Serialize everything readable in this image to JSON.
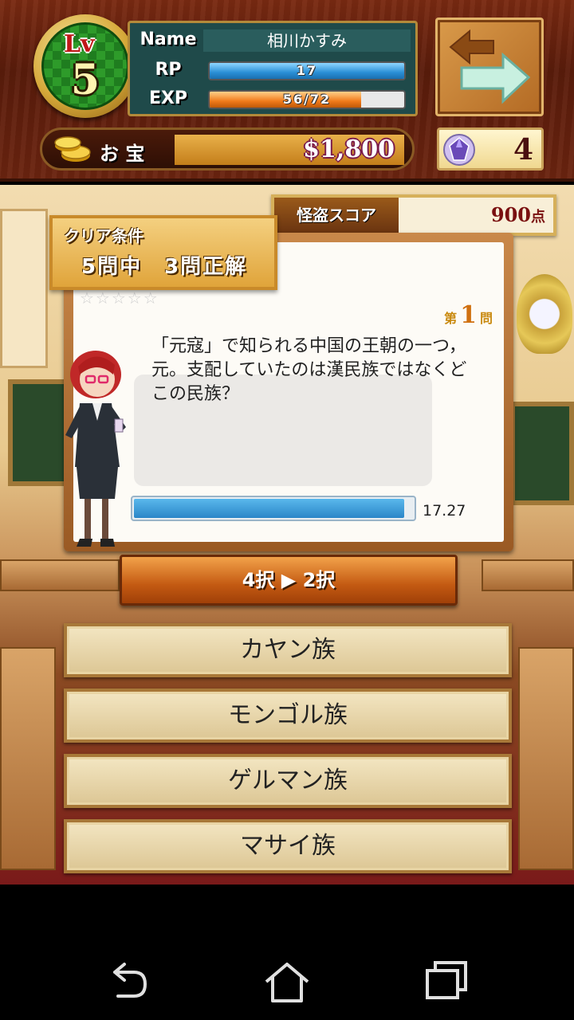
{
  "header": {
    "level_label": "Lv",
    "level": "5",
    "name_label": "Name",
    "player_name": "相川かすみ",
    "rp_label": "RP",
    "rp_value": "17",
    "rp_fraction": 1.0,
    "exp_label": "EXP",
    "exp_value": "56/72",
    "exp_fraction": 0.78,
    "treasure_label": "お 宝",
    "treasure_value": "$1,800",
    "gems": "4",
    "icons": [
      "back-arrow-icon",
      "forward-arrow-icon",
      "coin-stack-icon",
      "gem-icon"
    ]
  },
  "score": {
    "label": "怪盗スコア",
    "value": "900",
    "unit": "点"
  },
  "clear_condition": {
    "title": "クリア条件",
    "body": "5問中　3問正解"
  },
  "question": {
    "stars": "☆☆☆☆☆",
    "number_prefix": "第",
    "number": "1",
    "number_suffix": "問",
    "text": "「元寇」で知られる中国の王朝の一つ，元。支配していたのは漢民族ではなくどこの民族？",
    "timer": "17.27",
    "timer_fraction": 0.97
  },
  "hint_button": {
    "label": "4択 ▶ 2択"
  },
  "answers": [
    {
      "label": "カヤン族"
    },
    {
      "label": "モンゴル族"
    },
    {
      "label": "ゲルマン族"
    },
    {
      "label": "マサイ族"
    }
  ],
  "navbar": {
    "icons": [
      "back-icon",
      "home-icon",
      "recent-apps-icon"
    ]
  }
}
